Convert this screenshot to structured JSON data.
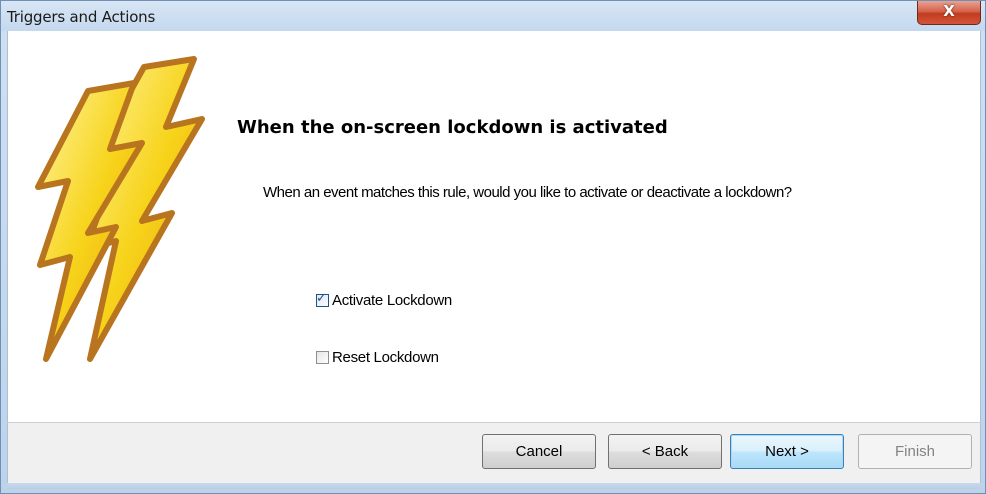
{
  "window": {
    "title": "Triggers and Actions",
    "close_label": "X"
  },
  "page": {
    "heading": "When the on-screen lockdown is activated",
    "description": "When an event matches this rule, would you like to activate or deactivate a lockdown?"
  },
  "options": [
    {
      "label": "Activate Lockdown",
      "checked": true
    },
    {
      "label": "Reset Lockdown",
      "checked": false
    }
  ],
  "buttons": {
    "cancel": "Cancel",
    "back": "< Back",
    "next": "Next >",
    "finish": "Finish",
    "finish_enabled": false
  },
  "icons": {
    "illustration": "lightning-bolts-icon"
  },
  "colors": {
    "bolt_fill": "#f7d31a",
    "bolt_outline": "#b8741e",
    "default_button_border": "#3c7fb1"
  }
}
